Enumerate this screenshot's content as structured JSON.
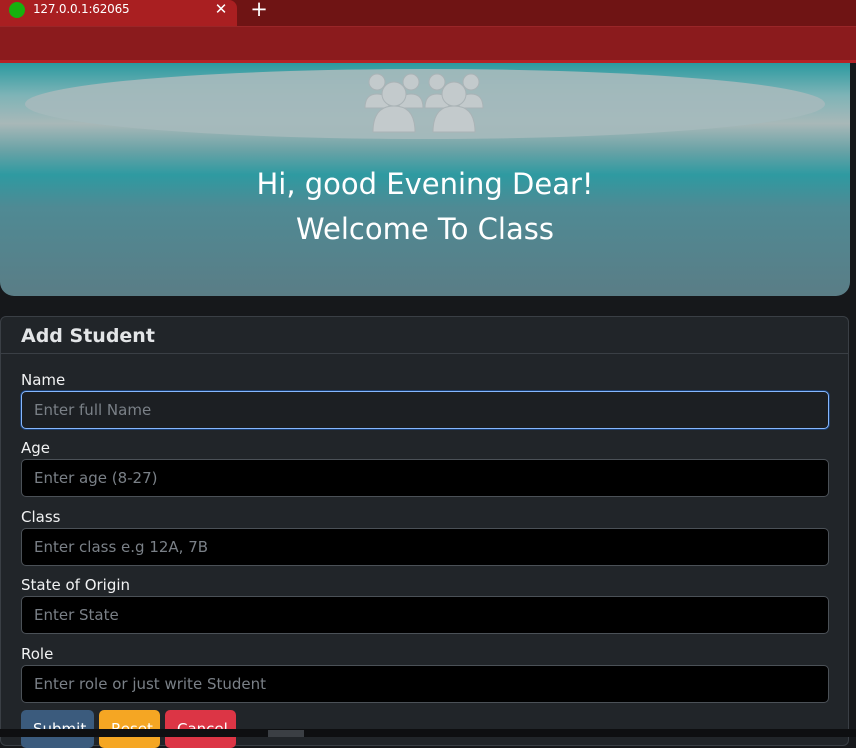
{
  "browser": {
    "tab_title": "127.0.0.1:62065",
    "tab_close": "✕",
    "new_tab": "+"
  },
  "hero": {
    "greeting": "Hi, good Evening Dear!",
    "welcome": "Welcome To Class",
    "icon": "users-group-icon"
  },
  "form": {
    "title": "Add Student",
    "fields": [
      {
        "label": "Name",
        "placeholder": "Enter full Name",
        "value": ""
      },
      {
        "label": "Age",
        "placeholder": "Enter age (8-27)",
        "value": ""
      },
      {
        "label": "Class",
        "placeholder": "Enter class e.g 12A, 7B",
        "value": ""
      },
      {
        "label": "State of Origin",
        "placeholder": "Enter State",
        "value": ""
      },
      {
        "label": "Role",
        "placeholder": "Enter role or just write Student",
        "value": ""
      }
    ],
    "buttons": {
      "submit": "Submit",
      "reset": "Reset",
      "cancel": "Cancel"
    }
  },
  "colors": {
    "tab_bar": "#6f1414",
    "active_tab": "#a91f21",
    "toolbar": "#8b1b1d",
    "card_bg": "#212529",
    "submit_button": "#3b5b7d",
    "reset_button": "#f5a623",
    "cancel_button": "#dc3545"
  }
}
